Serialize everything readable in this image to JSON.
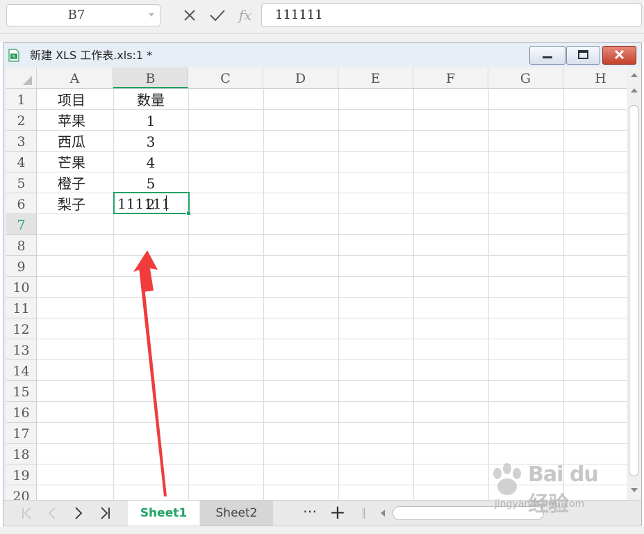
{
  "formula_bar": {
    "name_box": "B7",
    "cancel_icon": "close-x-icon",
    "confirm_icon": "check-icon",
    "fx_label": "fx",
    "formula_value": "111111"
  },
  "window": {
    "title": "新建 XLS 工作表.xls:1 *",
    "icon": "spreadsheet-doc-icon"
  },
  "columns": [
    "A",
    "B",
    "C",
    "D",
    "E",
    "F",
    "G",
    "H"
  ],
  "rows": [
    "1",
    "2",
    "3",
    "4",
    "5",
    "6",
    "7",
    "8",
    "9",
    "10",
    "11",
    "12",
    "13",
    "14",
    "15",
    "16",
    "17",
    "18",
    "19",
    "20"
  ],
  "table": {
    "header": {
      "item": "项目",
      "qty": "数量"
    },
    "rows": [
      {
        "item": "苹果",
        "qty": "1"
      },
      {
        "item": "西瓜",
        "qty": "3"
      },
      {
        "item": "芒果",
        "qty": "4"
      },
      {
        "item": "橙子",
        "qty": "5"
      },
      {
        "item": "梨子",
        "qty": "2"
      }
    ]
  },
  "active_cell": {
    "ref": "B7",
    "value": "111111"
  },
  "sheets": {
    "tabs": [
      {
        "label": "Sheet1",
        "active": true
      },
      {
        "label": "Sheet2",
        "active": false
      }
    ],
    "more": "⋯",
    "add": "+"
  },
  "watermark": {
    "text": "Bai du 经验",
    "url": "jingyan.baidu.com"
  },
  "colors": {
    "accent": "#21a366",
    "close": "#c4402c",
    "annotation_arrow": "#f03c3c"
  }
}
